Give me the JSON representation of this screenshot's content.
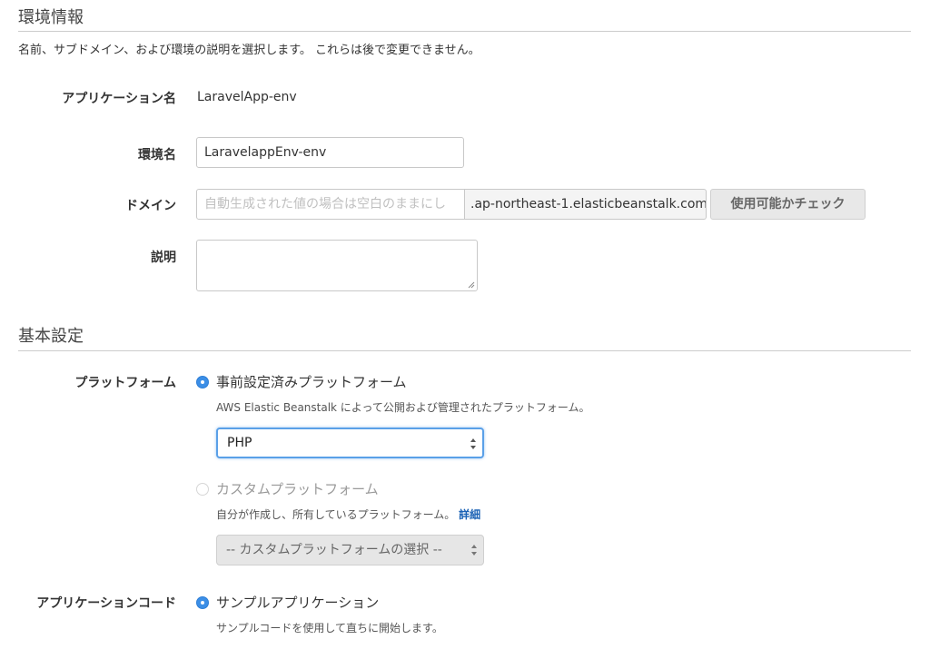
{
  "env_info": {
    "title": "環境情報",
    "description": "名前、サブドメイン、および環境の説明を選択します。 これらは後で変更できません。",
    "app_name_label": "アプリケーション名",
    "app_name_value": "LaravelApp-env",
    "env_name_label": "環境名",
    "env_name_value": "LaravelappEnv-env",
    "domain_label": "ドメイン",
    "domain_placeholder": "自動生成された値の場合は空白のままにし",
    "domain_suffix": ".ap-northeast-1.elasticbeanstalk.com",
    "check_button": "使用可能かチェック",
    "description_label": "説明"
  },
  "basic": {
    "title": "基本設定",
    "platform_label": "プラットフォーム",
    "preconfigured_label": "事前設定済みプラットフォーム",
    "preconfigured_hint": "AWS Elastic Beanstalk によって公開および管理されたプラットフォーム。",
    "preconfigured_value": "PHP",
    "custom_label": "カスタムプラットフォーム",
    "custom_hint": "自分が作成し、所有しているプラットフォーム。",
    "custom_link": "詳細",
    "custom_select": "-- カスタムプラットフォームの選択 --",
    "code_label": "アプリケーションコード",
    "sample_label": "サンプルアプリケーション",
    "sample_hint": "サンプルコードを使用して直ちに開始します。"
  },
  "colors": {
    "accent": "#3b8ee6",
    "link": "#1a62b5",
    "rule": "#cccccc"
  }
}
